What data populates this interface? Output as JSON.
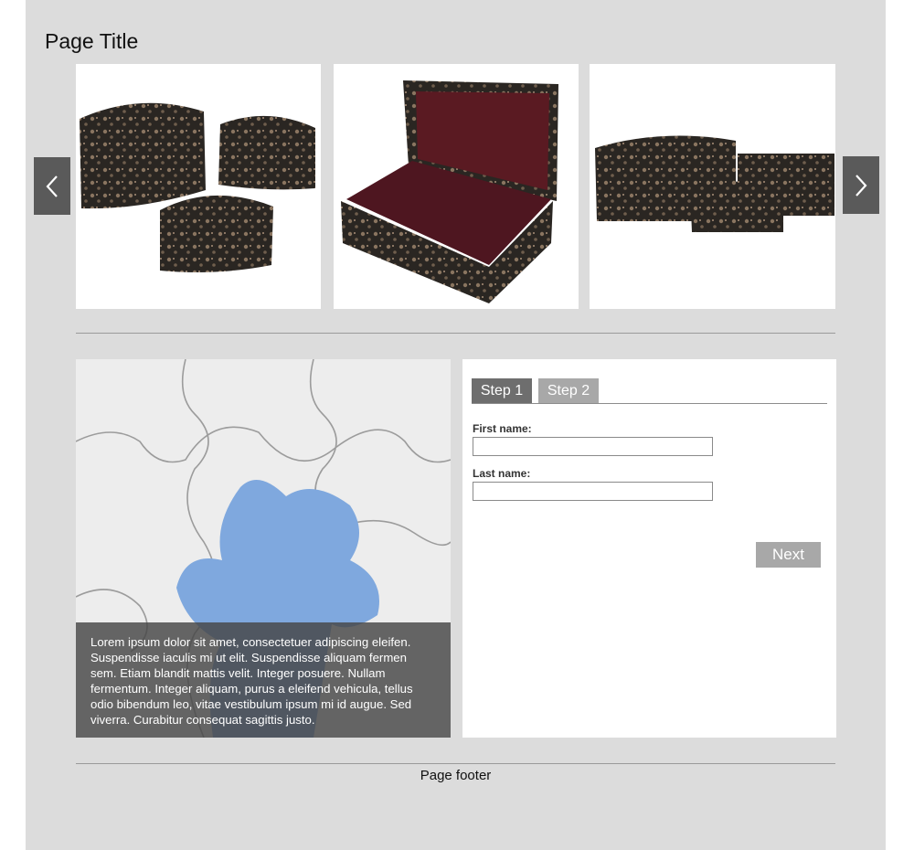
{
  "page": {
    "title": "Page Title",
    "footer": "Page footer"
  },
  "carousel": {
    "prev_icon": "chevron-left-icon",
    "next_icon": "chevron-right-icon",
    "slides": [
      {
        "image": "three-floral-lacquered-chests-photo"
      },
      {
        "image": "open-floral-chest-red-lining-photo"
      },
      {
        "image": "three-floral-chests-side-view-photo"
      }
    ]
  },
  "feature": {
    "image": "puzzle-missing-blue-piece-photo",
    "caption": "Lorem ipsum dolor sit amet, consectetuer adipiscing eleifen. Suspendisse iaculis mi ut elit. Suspendisse aliquam fermen sem. Etiam blandit mattis velit. Integer posuere. Nullam fermentum. Integer aliquam, purus a eleifend vehicula, tellus odio bibendum leo, vitae vestibulum ipsum mi id augue. Sed viverra. Curabitur consequat sagittis justo."
  },
  "form": {
    "tabs": [
      {
        "label": "Step 1",
        "active": true
      },
      {
        "label": "Step 2",
        "active": false
      }
    ],
    "first_name": {
      "label": "First name:",
      "value": "",
      "placeholder": ""
    },
    "last_name": {
      "label": "Last name:",
      "value": "",
      "placeholder": ""
    },
    "next_label": "Next"
  },
  "colors": {
    "page_bg": "#dcdcdc",
    "arrow_bg": "#5a5a5a",
    "tab_active": "#6e6e6e",
    "tab_inactive": "#a8a8a8",
    "button": "#a8a8a8",
    "puzzle_blue": "#7fa8de"
  }
}
